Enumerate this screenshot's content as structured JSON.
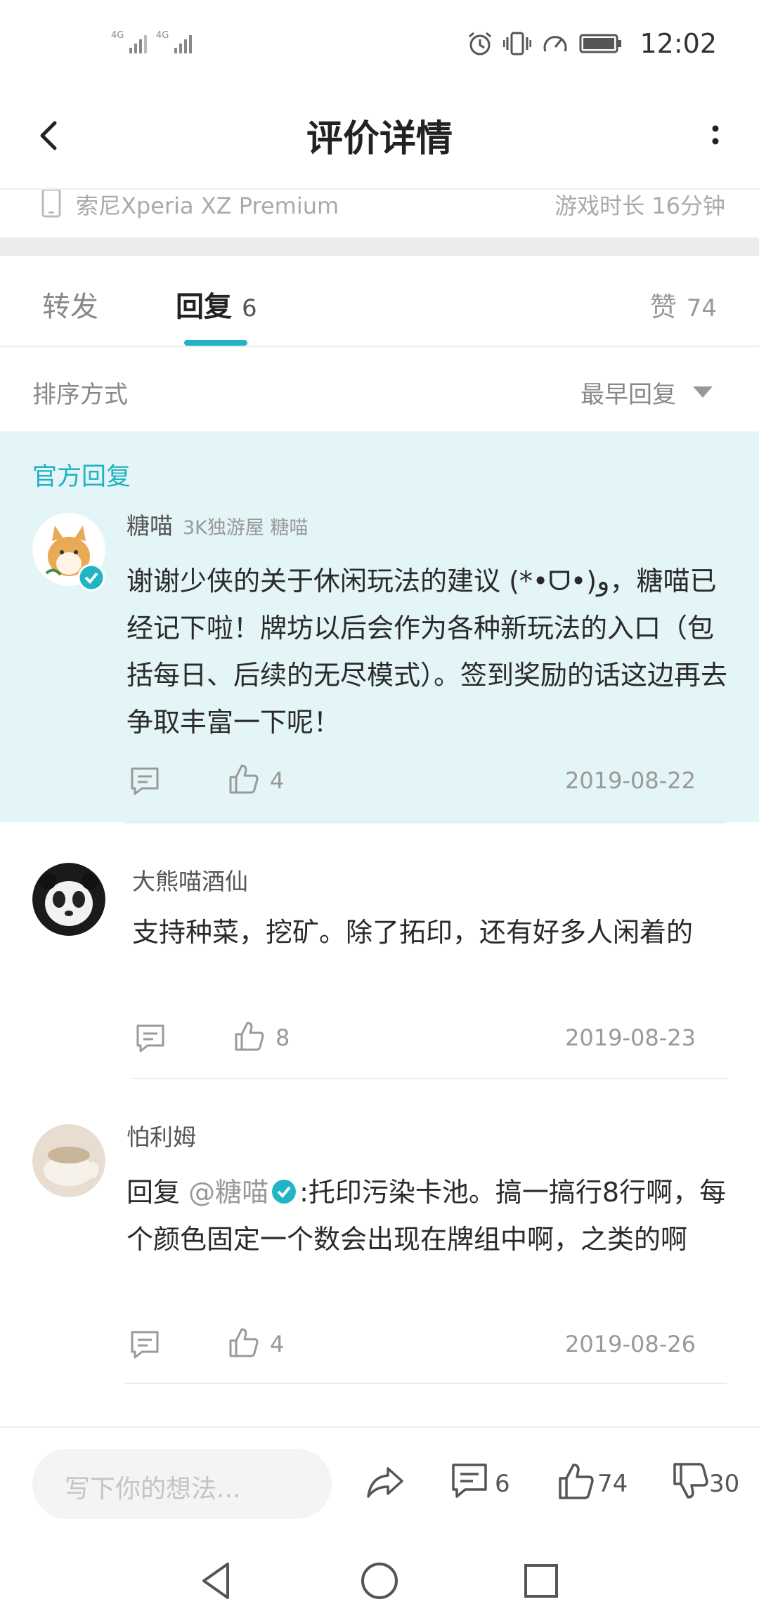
{
  "status_bar": {
    "signal_1": "4G",
    "signal_2": "4G",
    "time": "12:02",
    "icons": [
      "alarm-icon",
      "vibrate-icon",
      "data-saver-icon",
      "battery-icon"
    ]
  },
  "header": {
    "title": "评价详情",
    "back_icon": "chevron-left-icon",
    "more_icon": "more-vertical-icon"
  },
  "device_info": {
    "device": "索尼Xperia XZ Premium",
    "play_time": "游戏时长 16分钟"
  },
  "tabs": {
    "forward": "转发",
    "reply": "回复",
    "reply_count": "6",
    "like": "赞",
    "like_count": "74"
  },
  "sort": {
    "label": "排序方式",
    "value": "最早回复"
  },
  "official_tag": "官方回复",
  "comments": [
    {
      "name": "糖喵",
      "subtitle": "3K独游屋 糖喵",
      "text": "谢谢少侠的关于休闲玩法的建议 (*•ᗜ•)و，糖喵已经记下啦！牌坊以后会作为各种新玩法的入口（包括每日、后续的无尽模式）。签到奖励的话这边再去争取丰富一下呢！",
      "likes": "4",
      "date": "2019-08-22"
    },
    {
      "name": "大熊喵酒仙",
      "text": "支持种菜，挖矿。除了拓印，还有好多人闲着的",
      "likes": "8",
      "date": "2019-08-23"
    },
    {
      "name": "怕利姆",
      "reply_prefix": "回复 ",
      "reply_to": "@糖喵",
      "text": ":托印污染卡池。搞一搞行8行啊，每个颜色固定一个数会出现在牌组中啊，之类的啊",
      "likes": "4",
      "date": "2019-08-26"
    }
  ],
  "bottom_bar": {
    "input_placeholder": "写下你的想法...",
    "comment_count": "6",
    "like_count": "74",
    "dislike_count": "30"
  },
  "colors": {
    "accent": "#1fb5c6",
    "official_bg": "#e3f5f7",
    "text_primary": "#2a2a2a",
    "text_secondary": "#999999"
  }
}
